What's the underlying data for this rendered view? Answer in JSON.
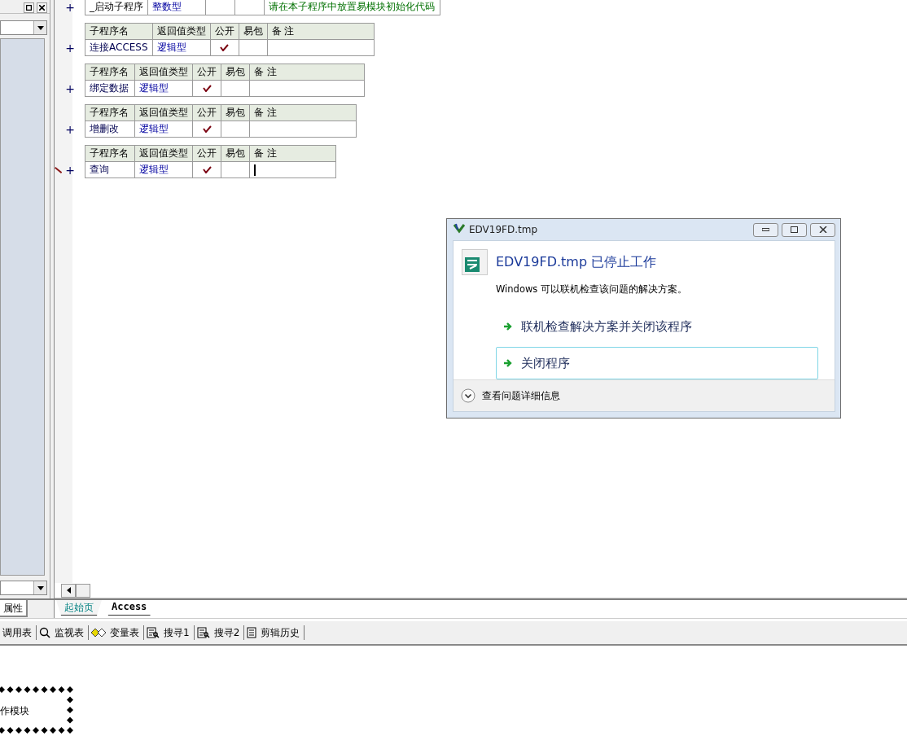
{
  "left_panel": {
    "tab": "属性"
  },
  "subroutines": [
    {
      "kind": "startup",
      "expander": "+",
      "name": "_启动子程序",
      "return_type": "整数型",
      "comment": "请在本子程序中放置易模块初始化代码"
    },
    {
      "kind": "table",
      "expander": "+",
      "headers": [
        "子程序名",
        "返回值类型",
        "公开",
        "易包",
        "备 注"
      ],
      "name": "连接ACCESS",
      "return_type": "逻辑型",
      "public": true,
      "easy_pack": false,
      "editing": false
    },
    {
      "kind": "table",
      "expander": "+",
      "headers": [
        "子程序名",
        "返回值类型",
        "公开",
        "易包",
        "备 注"
      ],
      "name": "绑定数据",
      "return_type": "逻辑型",
      "public": true,
      "easy_pack": false,
      "editing": false
    },
    {
      "kind": "table",
      "expander": "+",
      "headers": [
        "子程序名",
        "返回值类型",
        "公开",
        "易包",
        "备 注"
      ],
      "name": "增删改",
      "return_type": "逻辑型",
      "public": true,
      "easy_pack": false,
      "editing": false
    },
    {
      "kind": "table",
      "expander": "+",
      "headers": [
        "子程序名",
        "返回值类型",
        "公开",
        "易包",
        "备 注"
      ],
      "name": "查询",
      "return_type": "逻辑型",
      "public": true,
      "easy_pack": false,
      "editing": true
    }
  ],
  "doc_tabs": [
    {
      "label": "起始页",
      "selected": false
    },
    {
      "label": "Access",
      "selected": true
    }
  ],
  "toolbar": [
    {
      "label": "调用表",
      "kind": "plain"
    },
    {
      "label": "监视表",
      "kind": "watch"
    },
    {
      "label": "变量表",
      "kind": "variables"
    },
    {
      "label": "搜寻1",
      "kind": "find"
    },
    {
      "label": "搜寻2",
      "kind": "find"
    },
    {
      "label": "剪辑历史",
      "kind": "history"
    }
  ],
  "diagram": {
    "label": "作模块"
  },
  "dialog": {
    "title": "EDV19FD.tmp",
    "heading": "EDV19FD.tmp 已停止工作",
    "message": "Windows 可以联机检查该问题的解决方案。",
    "options": [
      {
        "label": "联机检查解决方案并关闭该程序",
        "hovered": false
      },
      {
        "label": "关闭程序",
        "hovered": true
      }
    ],
    "details": "查看问题详细信息"
  }
}
